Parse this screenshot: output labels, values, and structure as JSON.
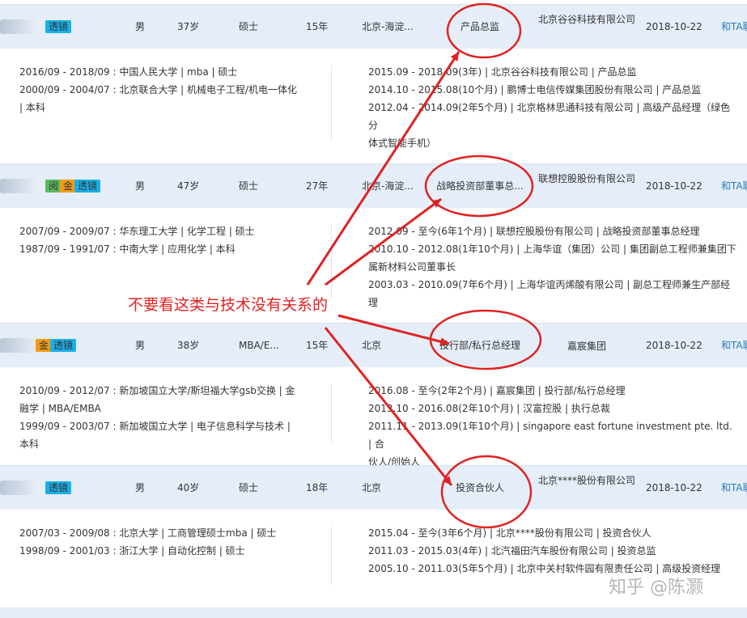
{
  "candidates": [
    {
      "badges": [
        {
          "text": "透镜",
          "kind": "tou"
        }
      ],
      "gender": "男",
      "age": "37岁",
      "degree": "硕士",
      "years": "15年",
      "location": "北京-海淀...",
      "title": "产品总监",
      "company": "北京谷谷科技有限公司",
      "date": "2018-10-22",
      "action": "和TA聊",
      "education": [
        "2016/09 - 2018/09 : 中国人民大学 | mba | 硕士",
        "2000/09 - 2004/07 : 北京联合大学 | 机械电子工程/机电一体化",
        "| 本科"
      ],
      "work": [
        "2015.09 - 2018.09(3年) | 北京谷谷科技有限公司 | 产品总监",
        "2014.10 - 2015.08(10个月) | 鹏博士电信传媒集团股份有限公司 | 产品总监",
        "2012.04 - 2014.09(2年5个月) | 北京格林思通科技有限公司 | 高级产品经理（绿色分",
        "体式智能手机）"
      ]
    },
    {
      "badges": [
        {
          "text": "阅",
          "kind": "yue"
        },
        {
          "text": "金",
          "kind": "jin"
        },
        {
          "text": "透镜",
          "kind": "tou"
        }
      ],
      "gender": "男",
      "age": "47岁",
      "degree": "硕士",
      "years": "27年",
      "location": "北京-海淀...",
      "title": "战略投资部董事总...",
      "company": "联想控股股份有限公司",
      "date": "2018-10-22",
      "action": "和TA聊",
      "education": [
        "2007/09 - 2009/07 : 华东理工大学 | 化学工程 | 硕士",
        "1987/09 - 1991/07 : 中南大学 | 应用化学 | 本科"
      ],
      "work": [
        "2012.09 - 至今(6年1个月) | 联想控股股份有限公司 | 战略投资部董事总经理",
        "2010.10 - 2012.08(1年10个月) | 上海华谊（集团）公司 | 集团副总工程师兼集团下",
        "属新材料公司董事长",
        "2003.03 - 2010.09(7年6个月) | 上海华谊丙烯酸有限公司 | 副总工程师兼生产部经理"
      ]
    },
    {
      "badges": [
        {
          "text": "金",
          "kind": "jin"
        },
        {
          "text": "透镜",
          "kind": "tou"
        }
      ],
      "gender": "男",
      "age": "38岁",
      "degree": "MBA/E...",
      "years": "15年",
      "location": "北京",
      "title": "投行部/私行总经理",
      "company": "嘉宸集团",
      "date": "2018-10-22",
      "action": "和TA聊",
      "education": [
        "2010/09 - 2012/07 : 新加坡国立大学/斯坦福大学gsb交换 | 金",
        "融学 | MBA/EMBA",
        "1999/09 - 2003/07 : 新加坡国立大学 | 电子信息科学与技术 |",
        "本科"
      ],
      "work": [
        "2016.08 - 至今(2年2个月) | 嘉宸集团 | 投行部/私行总经理",
        "2013.10 - 2016.08(2年10个月) | 汉富控股 | 执行总裁",
        "2011.11 - 2013.09(1年10个月) | singapore east fortune investment pte. ltd. | 合",
        "伙人/创始人"
      ]
    },
    {
      "badges": [
        {
          "text": "透镜",
          "kind": "tou"
        }
      ],
      "gender": "男",
      "age": "40岁",
      "degree": "硕士",
      "years": "18年",
      "location": "北京",
      "title": "投资合伙人",
      "company": "北京****股份有限公司",
      "date": "2018-10-22",
      "action": "和TA聊",
      "education": [
        "2007/03 - 2009/08 : 北京大学 | 工商管理硕士mba | 硕士",
        "1998/09 - 2001/03 : 浙江大学 | 自动化控制 | 硕士"
      ],
      "work": [
        "2015.04 - 至今(3年6个月) | 北京****股份有限公司 | 投资合伙人",
        "2011.03 - 2015.03(4年) | 北汽福田汽车股份有限公司 | 投资总监",
        "2005.10 - 2011.03(5年5个月) | 北京中关村软件园有限责任公司 | 高级投资经理"
      ]
    }
  ],
  "annotation": "不要看这类与技术没有关系的",
  "watermark": "知乎 @陈灏",
  "colors": {
    "annotation_red": "#e02222",
    "header_bg": "#e5eef8",
    "badge_tou": "#1ab0e8",
    "badge_jin": "#f39c12",
    "badge_yue": "#5cb85c"
  }
}
